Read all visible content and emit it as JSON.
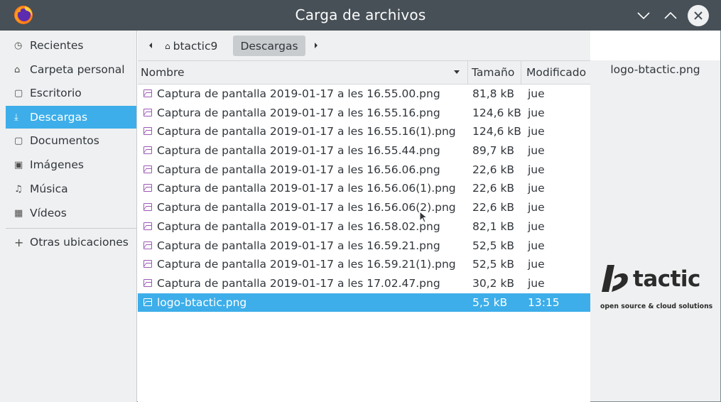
{
  "window": {
    "title": "Carga de archivos",
    "app_icon": "firefox-icon",
    "controls": [
      "minimize-icon",
      "maximize-icon",
      "close-icon"
    ]
  },
  "sidebar": {
    "items": [
      {
        "label": "Recientes",
        "icon": "clock-icon",
        "glyph": "◷",
        "active": false
      },
      {
        "label": "Carpeta personal",
        "icon": "home-icon",
        "glyph": "⌂",
        "active": false
      },
      {
        "label": "Escritorio",
        "icon": "desktop-folder-icon",
        "glyph": "▢",
        "active": false
      },
      {
        "label": "Descargas",
        "icon": "download-icon",
        "glyph": "⤓",
        "active": true
      },
      {
        "label": "Documentos",
        "icon": "documents-icon",
        "glyph": "▢",
        "active": false
      },
      {
        "label": "Imágenes",
        "icon": "image-icon",
        "glyph": "▣",
        "active": false
      },
      {
        "label": "Música",
        "icon": "music-icon",
        "glyph": "♫",
        "active": false
      },
      {
        "label": "Vídeos",
        "icon": "video-icon",
        "glyph": "▦",
        "active": false
      }
    ],
    "other": {
      "label": "Otras ubicaciones",
      "icon": "plus-icon",
      "glyph": "+"
    }
  },
  "pathbar": {
    "home_label": "btactic9",
    "current_label": "Descargas"
  },
  "columns": {
    "name": "Nombre",
    "size": "Tamaño",
    "modified": "Modificado"
  },
  "files": [
    {
      "name": "Captura de pantalla 2019-01-17 a les 16.55.00.png",
      "size": "81,8 kB",
      "modified": "jue"
    },
    {
      "name": "Captura de pantalla 2019-01-17 a les 16.55.16.png",
      "size": "124,6 kB",
      "modified": "jue"
    },
    {
      "name": "Captura de pantalla 2019-01-17 a les 16.55.16(1).png",
      "size": "124,6 kB",
      "modified": "jue"
    },
    {
      "name": "Captura de pantalla 2019-01-17 a les 16.55.44.png",
      "size": "89,7 kB",
      "modified": "jue"
    },
    {
      "name": "Captura de pantalla 2019-01-17 a les 16.56.06.png",
      "size": "22,6 kB",
      "modified": "jue"
    },
    {
      "name": "Captura de pantalla 2019-01-17 a les 16.56.06(1).png",
      "size": "22,6 kB",
      "modified": "jue"
    },
    {
      "name": "Captura de pantalla 2019-01-17 a les 16.56.06(2).png",
      "size": "22,6 kB",
      "modified": "jue"
    },
    {
      "name": "Captura de pantalla 2019-01-17 a les 16.58.02.png",
      "size": "82,1 kB",
      "modified": "jue"
    },
    {
      "name": "Captura de pantalla 2019-01-17 a les 16.59.21.png",
      "size": "52,5 kB",
      "modified": "jue"
    },
    {
      "name": "Captura de pantalla 2019-01-17 a les 16.59.21(1).png",
      "size": "52,5 kB",
      "modified": "jue"
    },
    {
      "name": "Captura de pantalla 2019-01-17 a les 17.02.47.png",
      "size": "30,2 kB",
      "modified": "jue"
    },
    {
      "name": "logo-btactic.png",
      "size": "5,5 kB",
      "modified": "13:15",
      "selected": true
    }
  ],
  "preview": {
    "filename": "logo-btactic.png",
    "logo_word": "tactic",
    "logo_tagline": "open source & cloud solutions"
  },
  "colors": {
    "accent": "#3daee9",
    "titlebar": "#475057",
    "sidebar_bg": "#eff0f1",
    "image_icon": "#9b59b6"
  }
}
